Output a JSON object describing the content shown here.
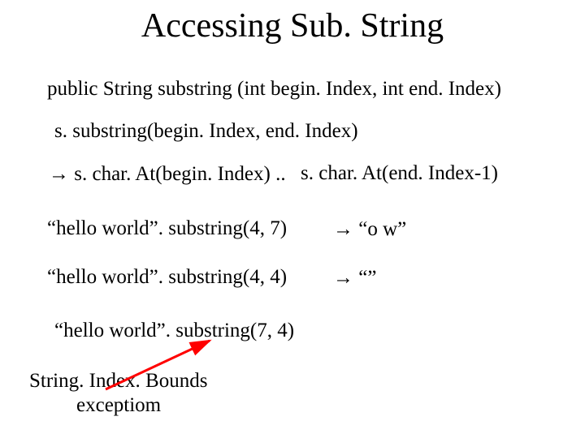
{
  "title": "Accessing Sub. String",
  "lines": {
    "signature": "public String substring (int begin. Index, int end. Index)",
    "call": "s. substring(begin. Index, end. Index)",
    "expansion_left": " s. char. At(begin. Index) .. ",
    "expansion_right": "s. char. At(end. Index-1)",
    "ex1_left": "“hello world”. substring(4, 7)",
    "ex1_arrow": " ",
    "ex1_right": "“o w”",
    "ex2_left": "“hello world”. substring(4, 4)",
    "ex2_arrow": " ",
    "ex2_right": "“”",
    "ex3": "“hello world”. substring(7, 4)",
    "exception_l1": "String. Index. Bounds",
    "exception_l2": "exceptiom"
  },
  "glyphs": {
    "right_arrow": "→"
  }
}
